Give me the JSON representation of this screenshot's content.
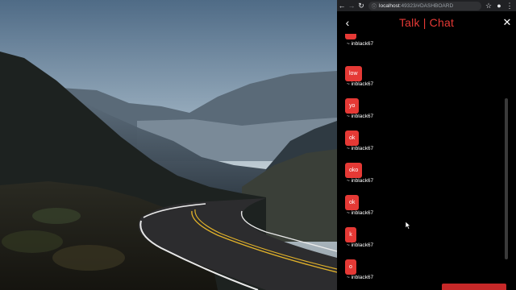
{
  "browser": {
    "url_host": "localhost",
    "url_rest": ":49323/#DASHBOARD"
  },
  "header": {
    "title": "Talk | Chat",
    "back_icon": "arrow-left-icon",
    "close_icon": "close-icon"
  },
  "messages": [
    {
      "text": "",
      "author": "~ inblack67"
    },
    {
      "text": "low",
      "author": "~ inblack67"
    },
    {
      "text": "yo",
      "author": "~ inblack67"
    },
    {
      "text": "ok",
      "author": "~ inblack67"
    },
    {
      "text": "oko",
      "author": "~ inblack67"
    },
    {
      "text": "ok",
      "author": "~ inblack67"
    },
    {
      "text": "k",
      "author": "~ inblack67"
    },
    {
      "text": "o",
      "author": "~ inblack67"
    }
  ],
  "colors": {
    "accent": "#e53935",
    "background": "#000000",
    "text": "#ffffff"
  }
}
